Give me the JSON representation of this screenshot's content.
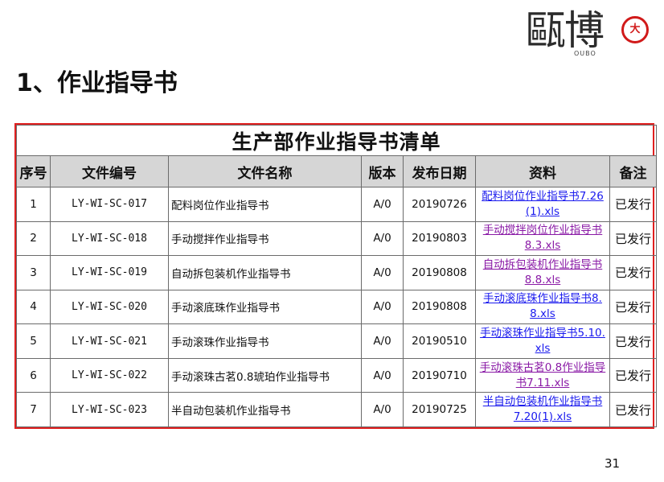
{
  "logo": {
    "chars": "甌博",
    "seal_char": "大",
    "subtext": "OUBO"
  },
  "heading": "1、作业指导书",
  "table": {
    "title": "生产部作业指导书清单",
    "headers": [
      "序号",
      "文件编号",
      "文件名称",
      "版本",
      "发布日期",
      "资料",
      "备注"
    ],
    "rows": [
      {
        "no": "1",
        "code": "LY-WI-SC-017",
        "name": "配料岗位作业指导书",
        "version": "A/0",
        "date": "20190726",
        "file": "配料岗位作业指导书7.26(1).xls",
        "file_color": "blue",
        "status": "已发行"
      },
      {
        "no": "2",
        "code": "LY-WI-SC-018",
        "name": "手动搅拌作业指导书",
        "version": "A/0",
        "date": "20190803",
        "file": "手动搅拌岗位作业指导书8.3.xls",
        "file_color": "purple",
        "status": "已发行"
      },
      {
        "no": "3",
        "code": "LY-WI-SC-019",
        "name": "自动拆包装机作业指导书",
        "version": "A/0",
        "date": "20190808",
        "file": "自动拆包装机作业指导书8.8.xls",
        "file_color": "purple",
        "status": "已发行"
      },
      {
        "no": "4",
        "code": "LY-WI-SC-020",
        "name": "手动滚底珠作业指导书",
        "version": "A/0",
        "date": "20190808",
        "file": "手动滚底珠作业指导书8.8.xls",
        "file_color": "blue",
        "status": "已发行"
      },
      {
        "no": "5",
        "code": "LY-WI-SC-021",
        "name": "手动滚珠作业指导书",
        "version": "A/0",
        "date": "20190510",
        "file": "手动滚珠作业指导书5.10.xls",
        "file_color": "blue",
        "status": "已发行"
      },
      {
        "no": "6",
        "code": "LY-WI-SC-022",
        "name": "手动滚珠古茗0.8琥珀作业指导书",
        "version": "A/0",
        "date": "20190710",
        "file": "手动滚珠古茗0.8作业指导书7.11.xls",
        "file_color": "purple",
        "status": "已发行"
      },
      {
        "no": "7",
        "code": "LY-WI-SC-023",
        "name": "半自动包装机作业指导书",
        "version": "A/0",
        "date": "20190725",
        "file": "半自动包装机作业指导书7.20(1).xls",
        "file_color": "blue",
        "status": "已发行"
      }
    ]
  },
  "page_number": "31"
}
